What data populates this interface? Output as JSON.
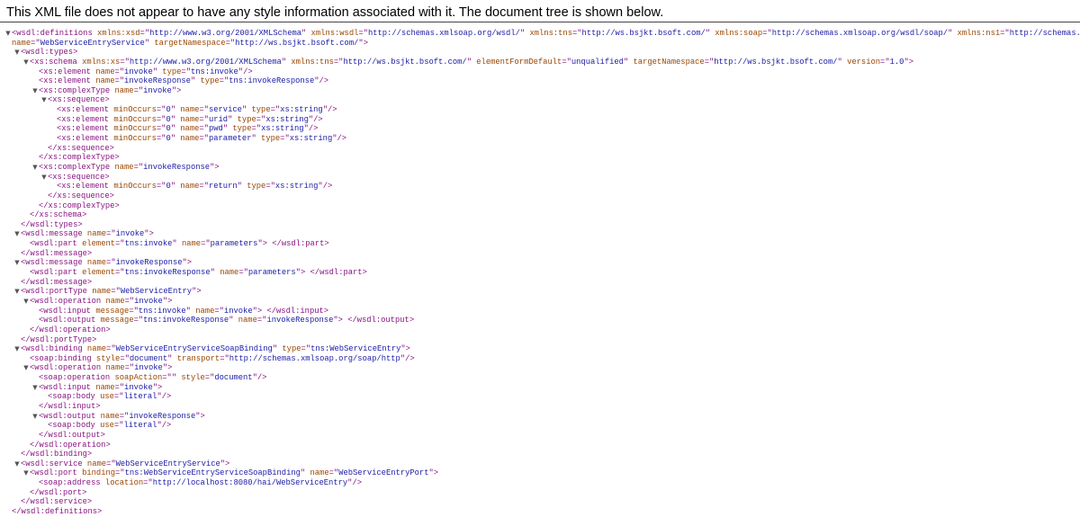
{
  "header": {
    "message": "This XML file does not appear to have any style information associated with it. The document tree is shown below."
  },
  "colors": {
    "tag": "#881280",
    "attribute_name": "#994500",
    "attribute_value": "#1a1aa6",
    "toggle": "#555555",
    "rule": "#444444"
  },
  "toggle_icon": "triangle-down-icon",
  "lines": [
    {
      "indent": 0,
      "toggle": true,
      "kind": "open",
      "tag": "wsdl:definitions",
      "attrs": [
        [
          "xmlns:xsd",
          "http://www.w3.org/2001/XMLSchema"
        ],
        [
          "xmlns:wsdl",
          "http://schemas.xmlsoap.org/wsdl/"
        ],
        [
          "xmlns:tns",
          "http://ws.bsjkt.bsoft.com/"
        ],
        [
          "xmlns:soap",
          "http://schemas.xmlsoap.org/wsdl/soap/"
        ],
        [
          "xmlns:ns1",
          "http://schemas.xmlsoap.org/soap/h"
        ]
      ],
      "continues": true
    },
    {
      "indent": 0,
      "toggle": false,
      "kind": "cont",
      "attrs": [
        [
          "name",
          "WebServiceEntryService"
        ],
        [
          "targetNamespace",
          "http://ws.bsjkt.bsoft.com/"
        ]
      ],
      "end": ">"
    },
    {
      "indent": 1,
      "toggle": true,
      "kind": "open",
      "tag": "wsdl:types",
      "attrs": []
    },
    {
      "indent": 2,
      "toggle": true,
      "kind": "open",
      "tag": "xs:schema",
      "attrs": [
        [
          "xmlns:xs",
          "http://www.w3.org/2001/XMLSchema"
        ],
        [
          "xmlns:tns",
          "http://ws.bsjkt.bsoft.com/"
        ],
        [
          "elementFormDefault",
          "unqualified"
        ],
        [
          "targetNamespace",
          "http://ws.bsjkt.bsoft.com/"
        ],
        [
          "version",
          "1.0"
        ]
      ]
    },
    {
      "indent": 3,
      "toggle": false,
      "kind": "self",
      "tag": "xs:element",
      "attrs": [
        [
          "name",
          "invoke"
        ],
        [
          "type",
          "tns:invoke"
        ]
      ]
    },
    {
      "indent": 3,
      "toggle": false,
      "kind": "self",
      "tag": "xs:element",
      "attrs": [
        [
          "name",
          "invokeResponse"
        ],
        [
          "type",
          "tns:invokeResponse"
        ]
      ]
    },
    {
      "indent": 3,
      "toggle": true,
      "kind": "open",
      "tag": "xs:complexType",
      "attrs": [
        [
          "name",
          "invoke"
        ]
      ]
    },
    {
      "indent": 4,
      "toggle": true,
      "kind": "open",
      "tag": "xs:sequence",
      "attrs": []
    },
    {
      "indent": 5,
      "toggle": false,
      "kind": "self",
      "tag": "xs:element",
      "attrs": [
        [
          "minOccurs",
          "0"
        ],
        [
          "name",
          "service"
        ],
        [
          "type",
          "xs:string"
        ]
      ]
    },
    {
      "indent": 5,
      "toggle": false,
      "kind": "self",
      "tag": "xs:element",
      "attrs": [
        [
          "minOccurs",
          "0"
        ],
        [
          "name",
          "urid"
        ],
        [
          "type",
          "xs:string"
        ]
      ]
    },
    {
      "indent": 5,
      "toggle": false,
      "kind": "self",
      "tag": "xs:element",
      "attrs": [
        [
          "minOccurs",
          "0"
        ],
        [
          "name",
          "pwd"
        ],
        [
          "type",
          "xs:string"
        ]
      ]
    },
    {
      "indent": 5,
      "toggle": false,
      "kind": "self",
      "tag": "xs:element",
      "attrs": [
        [
          "minOccurs",
          "0"
        ],
        [
          "name",
          "parameter"
        ],
        [
          "type",
          "xs:string"
        ]
      ]
    },
    {
      "indent": 4,
      "toggle": false,
      "kind": "close",
      "tag": "xs:sequence"
    },
    {
      "indent": 3,
      "toggle": false,
      "kind": "close",
      "tag": "xs:complexType"
    },
    {
      "indent": 3,
      "toggle": true,
      "kind": "open",
      "tag": "xs:complexType",
      "attrs": [
        [
          "name",
          "invokeResponse"
        ]
      ]
    },
    {
      "indent": 4,
      "toggle": true,
      "kind": "open",
      "tag": "xs:sequence",
      "attrs": []
    },
    {
      "indent": 5,
      "toggle": false,
      "kind": "self",
      "tag": "xs:element",
      "attrs": [
        [
          "minOccurs",
          "0"
        ],
        [
          "name",
          "return"
        ],
        [
          "type",
          "xs:string"
        ]
      ]
    },
    {
      "indent": 4,
      "toggle": false,
      "kind": "close",
      "tag": "xs:sequence"
    },
    {
      "indent": 3,
      "toggle": false,
      "kind": "close",
      "tag": "xs:complexType"
    },
    {
      "indent": 2,
      "toggle": false,
      "kind": "close",
      "tag": "xs:schema"
    },
    {
      "indent": 1,
      "toggle": false,
      "kind": "close",
      "tag": "wsdl:types"
    },
    {
      "indent": 1,
      "toggle": true,
      "kind": "open",
      "tag": "wsdl:message",
      "attrs": [
        [
          "name",
          "invoke"
        ]
      ]
    },
    {
      "indent": 2,
      "toggle": false,
      "kind": "inline",
      "tag": "wsdl:part",
      "attrs": [
        [
          "element",
          "tns:invoke"
        ],
        [
          "name",
          "parameters"
        ]
      ]
    },
    {
      "indent": 1,
      "toggle": false,
      "kind": "close",
      "tag": "wsdl:message"
    },
    {
      "indent": 1,
      "toggle": true,
      "kind": "open",
      "tag": "wsdl:message",
      "attrs": [
        [
          "name",
          "invokeResponse"
        ]
      ]
    },
    {
      "indent": 2,
      "toggle": false,
      "kind": "inline",
      "tag": "wsdl:part",
      "attrs": [
        [
          "element",
          "tns:invokeResponse"
        ],
        [
          "name",
          "parameters"
        ]
      ]
    },
    {
      "indent": 1,
      "toggle": false,
      "kind": "close",
      "tag": "wsdl:message"
    },
    {
      "indent": 1,
      "toggle": true,
      "kind": "open",
      "tag": "wsdl:portType",
      "attrs": [
        [
          "name",
          "WebServiceEntry"
        ]
      ]
    },
    {
      "indent": 2,
      "toggle": true,
      "kind": "open",
      "tag": "wsdl:operation",
      "attrs": [
        [
          "name",
          "invoke"
        ]
      ]
    },
    {
      "indent": 3,
      "toggle": false,
      "kind": "inline",
      "tag": "wsdl:input",
      "attrs": [
        [
          "message",
          "tns:invoke"
        ],
        [
          "name",
          "invoke"
        ]
      ]
    },
    {
      "indent": 3,
      "toggle": false,
      "kind": "inline",
      "tag": "wsdl:output",
      "attrs": [
        [
          "message",
          "tns:invokeResponse"
        ],
        [
          "name",
          "invokeResponse"
        ]
      ]
    },
    {
      "indent": 2,
      "toggle": false,
      "kind": "close",
      "tag": "wsdl:operation"
    },
    {
      "indent": 1,
      "toggle": false,
      "kind": "close",
      "tag": "wsdl:portType"
    },
    {
      "indent": 1,
      "toggle": true,
      "kind": "open",
      "tag": "wsdl:binding",
      "attrs": [
        [
          "name",
          "WebServiceEntryServiceSoapBinding"
        ],
        [
          "type",
          "tns:WebServiceEntry"
        ]
      ]
    },
    {
      "indent": 2,
      "toggle": false,
      "kind": "self",
      "tag": "soap:binding",
      "attrs": [
        [
          "style",
          "document"
        ],
        [
          "transport",
          "http://schemas.xmlsoap.org/soap/http"
        ]
      ]
    },
    {
      "indent": 2,
      "toggle": true,
      "kind": "open",
      "tag": "wsdl:operation",
      "attrs": [
        [
          "name",
          "invoke"
        ]
      ]
    },
    {
      "indent": 3,
      "toggle": false,
      "kind": "self",
      "tag": "soap:operation",
      "attrs": [
        [
          "soapAction",
          ""
        ],
        [
          "style",
          "document"
        ]
      ]
    },
    {
      "indent": 3,
      "toggle": true,
      "kind": "open",
      "tag": "wsdl:input",
      "attrs": [
        [
          "name",
          "invoke"
        ]
      ]
    },
    {
      "indent": 4,
      "toggle": false,
      "kind": "self",
      "tag": "soap:body",
      "attrs": [
        [
          "use",
          "literal"
        ]
      ]
    },
    {
      "indent": 3,
      "toggle": false,
      "kind": "close",
      "tag": "wsdl:input"
    },
    {
      "indent": 3,
      "toggle": true,
      "kind": "open",
      "tag": "wsdl:output",
      "attrs": [
        [
          "name",
          "invokeResponse"
        ]
      ]
    },
    {
      "indent": 4,
      "toggle": false,
      "kind": "self",
      "tag": "soap:body",
      "attrs": [
        [
          "use",
          "literal"
        ]
      ]
    },
    {
      "indent": 3,
      "toggle": false,
      "kind": "close",
      "tag": "wsdl:output"
    },
    {
      "indent": 2,
      "toggle": false,
      "kind": "close",
      "tag": "wsdl:operation"
    },
    {
      "indent": 1,
      "toggle": false,
      "kind": "close",
      "tag": "wsdl:binding"
    },
    {
      "indent": 1,
      "toggle": true,
      "kind": "open",
      "tag": "wsdl:service",
      "attrs": [
        [
          "name",
          "WebServiceEntryService"
        ]
      ]
    },
    {
      "indent": 2,
      "toggle": true,
      "kind": "open",
      "tag": "wsdl:port",
      "attrs": [
        [
          "binding",
          "tns:WebServiceEntryServiceSoapBinding"
        ],
        [
          "name",
          "WebServiceEntryPort"
        ]
      ]
    },
    {
      "indent": 3,
      "toggle": false,
      "kind": "self",
      "tag": "soap:address",
      "attrs": [
        [
          "location",
          "http://localhost:8080/hai/WebServiceEntry"
        ]
      ]
    },
    {
      "indent": 2,
      "toggle": false,
      "kind": "close",
      "tag": "wsdl:port"
    },
    {
      "indent": 1,
      "toggle": false,
      "kind": "close",
      "tag": "wsdl:service"
    },
    {
      "indent": 0,
      "toggle": false,
      "kind": "close",
      "tag": "wsdl:definitions"
    }
  ]
}
